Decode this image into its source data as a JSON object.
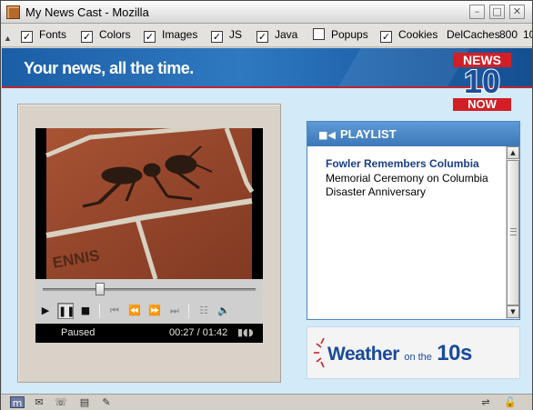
{
  "window": {
    "title": "My News Cast - Mozilla",
    "controls": {
      "minimize": "–",
      "maximize": "□",
      "close": "✕"
    }
  },
  "toolbar": {
    "items": [
      {
        "label": "Fonts",
        "checked": true
      },
      {
        "label": "Colors",
        "checked": true
      },
      {
        "label": "Images",
        "checked": true
      },
      {
        "label": "JS",
        "checked": true
      },
      {
        "label": "Java",
        "checked": true
      },
      {
        "label": "Popups",
        "checked": false
      },
      {
        "label": "Cookies",
        "checked": true
      }
    ],
    "extra_label": "DelCaches",
    "extra_value_1": "800",
    "extra_value_2": "10"
  },
  "banner": {
    "slogan": "Your news, all the time.",
    "logo_top": "NEWS",
    "logo_number": "10",
    "logo_bottom": "NOW"
  },
  "player": {
    "video_caption": "ENNIS",
    "seek_progress": 0.27,
    "status": "Paused",
    "time": "00:27 / 01:42"
  },
  "playlist": {
    "header": "PLAYLIST",
    "items": [
      {
        "title": "Fowler Remembers Columbia",
        "description": "Memorial Ceremony on Columbia Disaster Anniversary"
      }
    ]
  },
  "ad": {
    "weather_word": "Weather",
    "on_the": "on the",
    "tens": "10s"
  },
  "colors": {
    "banner_blue": "#1f64ad",
    "playlist_header": "#3c78b8",
    "accent_red": "#d21f26",
    "page_background": "#d3eaf8"
  }
}
